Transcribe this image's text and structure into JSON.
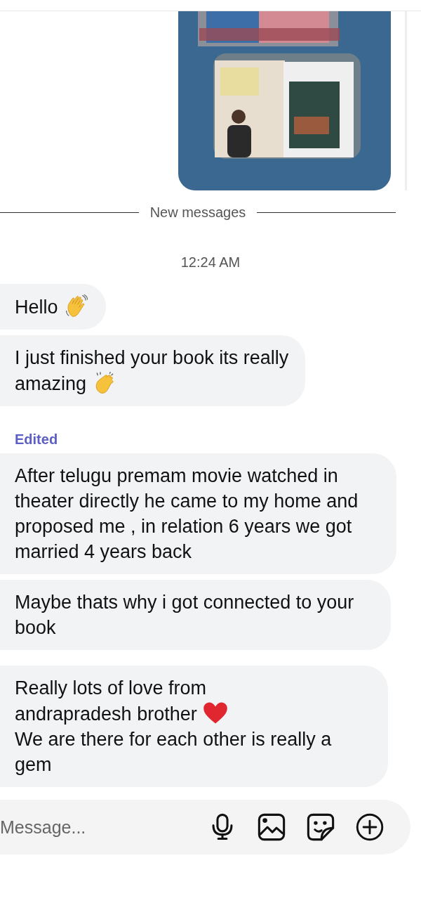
{
  "divider": {
    "label": "New messages"
  },
  "timestamp": "12:24 AM",
  "messages": [
    {
      "parts": [
        {
          "kind": "text",
          "text": "Hello"
        },
        {
          "kind": "wave"
        }
      ],
      "edited": false
    },
    {
      "parts": [
        {
          "kind": "text",
          "text": "I just finished your book its really"
        },
        {
          "kind": "break"
        },
        {
          "kind": "text",
          "text": "amazing"
        },
        {
          "kind": "clap"
        }
      ],
      "edited": false
    },
    {
      "edited_label": "Edited",
      "parts": [
        {
          "kind": "text",
          "text": "After telugu premam movie watched in theater directly he came to my home and   proposed me , in relation 6 years we got married 4 years back"
        }
      ],
      "edited": true
    },
    {
      "parts": [
        {
          "kind": "text",
          "text": "Maybe thats why i got connected to your book"
        }
      ],
      "edited": false
    },
    {
      "parts": [
        {
          "kind": "text",
          "text": "Really lots of love from"
        },
        {
          "kind": "break"
        },
        {
          "kind": "text",
          "text": "andrapradesh brother"
        },
        {
          "kind": "heart"
        },
        {
          "kind": "break"
        },
        {
          "kind": "text",
          "text": "We are there for each other is really a gem"
        }
      ],
      "edited": false
    }
  ],
  "composer": {
    "placeholder": "Message..."
  }
}
